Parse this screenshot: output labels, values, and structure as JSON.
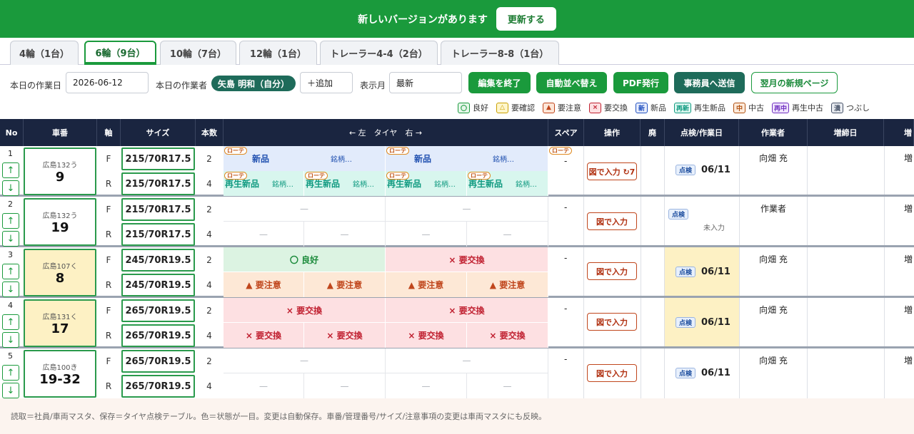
{
  "banner": {
    "message": "新しいバージョンがあります",
    "button": "更新する"
  },
  "tabs": [
    {
      "label": "4輪（1台）"
    },
    {
      "label": "6輪（9台）",
      "active": true
    },
    {
      "label": "10輪（7台）"
    },
    {
      "label": "12輪（1台）"
    },
    {
      "label": "トレーラー4-4（2台）"
    },
    {
      "label": "トレーラー8-8（1台）"
    }
  ],
  "toolbar": {
    "work_date_label": "本日の作業日",
    "work_date_value": "2026-06-12",
    "worker_label": "本日の作業者",
    "worker_chip": "矢島 明和（自分）",
    "add_button": "＋追加",
    "display_month_label": "表示月",
    "display_month_value": "最新",
    "buttons": {
      "finish_edit": "編集を終了",
      "auto_sort": "自動並べ替え",
      "pdf": "PDF発行",
      "send_office": "事務員へ送信",
      "next_month": "翌月の新規ページ"
    }
  },
  "legend": [
    {
      "mark": "〇",
      "label": "良好",
      "color": "#1a9a3c",
      "bg": "#e6f6ea"
    },
    {
      "mark": "△",
      "label": "要確認",
      "color": "#c9a000",
      "bg": "#fff6cc"
    },
    {
      "mark": "▲",
      "label": "要注意",
      "color": "#c0461c",
      "bg": "#fde6d8"
    },
    {
      "mark": "×",
      "label": "要交換",
      "color": "#c02030",
      "bg": "#fde0e2"
    },
    {
      "mark": "新",
      "label": "新品",
      "color": "#2050c0",
      "bg": "#e6ecfc"
    },
    {
      "mark": "再新",
      "label": "再生新品",
      "color": "#109a80",
      "bg": "#dcf7f0"
    },
    {
      "mark": "中",
      "label": "中古",
      "color": "#b05010",
      "bg": "#fdebdc"
    },
    {
      "mark": "再中",
      "label": "再生中古",
      "color": "#7030c0",
      "bg": "#efe4fc"
    },
    {
      "mark": "潰",
      "label": "つぶし",
      "color": "#445066",
      "bg": "#e8ebf0"
    }
  ],
  "table": {
    "headers": {
      "no": "No",
      "car": "車番",
      "axle": "軸",
      "size": "サイズ",
      "count": "本数",
      "tire": "← 左　タイヤ　右 →",
      "spare": "スペア",
      "action": "操作",
      "scrap": "廃",
      "inspect_date": "点検/作業日",
      "worker": "作業者",
      "retighten": "増締日",
      "extra": "増"
    },
    "rows": [
      {
        "no": "1",
        "plate": "広島132う",
        "car_no": "9",
        "car_bg": "#ffffff",
        "axles": [
          {
            "axle": "F",
            "size": "215/70R17.5",
            "count": "2"
          },
          {
            "axle": "R",
            "size": "215/70R17.5",
            "count": "4"
          }
        ],
        "spare": "-",
        "action": "図で入力 ↻7",
        "inspect_badge": "点検",
        "inspect_date": "06/11",
        "worker": "向畑 充",
        "extra": "増"
      },
      {
        "no": "2",
        "plate": "広島132う",
        "car_no": "19",
        "car_bg": "#ffffff",
        "axles": [
          {
            "axle": "F",
            "size": "215/70R17.5",
            "count": "2"
          },
          {
            "axle": "R",
            "size": "215/70R17.5",
            "count": "4"
          }
        ],
        "spare": "-",
        "action": "図で入力",
        "inspect_badge": "点検",
        "inspect_date": "未入力",
        "worker": "作業者",
        "extra": "増"
      },
      {
        "no": "3",
        "plate": "広島107く",
        "car_no": "8",
        "car_bg": "#fdf1c4",
        "axles": [
          {
            "axle": "F",
            "size": "245/70R19.5",
            "count": "2"
          },
          {
            "axle": "R",
            "size": "245/70R19.5",
            "count": "4"
          }
        ],
        "spare": "-",
        "action": "図で入力",
        "inspect_badge": "点検",
        "inspect_date": "06/11",
        "worker": "向畑 充",
        "extra": "増"
      },
      {
        "no": "4",
        "plate": "広島131く",
        "car_no": "17",
        "car_bg": "#fdf1c4",
        "axles": [
          {
            "axle": "F",
            "size": "265/70R19.5",
            "count": "2"
          },
          {
            "axle": "R",
            "size": "265/70R19.5",
            "count": "4"
          }
        ],
        "spare": "-",
        "action": "図で入力",
        "inspect_badge": "点検",
        "inspect_date": "06/11",
        "worker": "向畑 充",
        "extra": "増"
      },
      {
        "no": "5",
        "plate": "広島100き",
        "car_no": "19-32",
        "car_bg": "#ffffff",
        "axles": [
          {
            "axle": "F",
            "size": "265/70R19.5",
            "count": "2"
          },
          {
            "axle": "R",
            "size": "265/70R19.5",
            "count": "4"
          }
        ],
        "spare": "-",
        "action": "図で入力",
        "inspect_badge": "点検",
        "inspect_date": "06/11",
        "worker": "向畑 充",
        "extra": "増"
      }
    ],
    "tires": {
      "rotation_tag": "ローテ",
      "brand_placeholder": "銘柄…",
      "row1_front": [
        "新品",
        "新品"
      ],
      "row1_rear": [
        "再生新品",
        "再生新品",
        "再生新品",
        "再生新品"
      ],
      "dash": "—",
      "row3_front": [
        "〇 良好",
        "× 要交換"
      ],
      "row3_rear": [
        "▲ 要注意",
        "▲ 要注意",
        "▲ 要注意",
        "▲ 要注意"
      ],
      "row4_front": [
        "× 要交換",
        "× 要交換"
      ],
      "row4_rear": [
        "× 要交換",
        "× 要交換",
        "× 要交換",
        "× 要交換"
      ]
    }
  },
  "footer": "読取＝社員/車両マスタ、保存＝タイヤ点検テーブル。色＝状態が一目。変更は自動保存。車番/管理番号/サイズ/注意事項の変更は車両マスタにも反映。"
}
